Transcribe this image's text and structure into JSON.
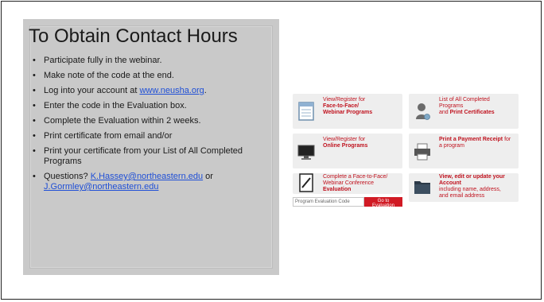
{
  "slide": {
    "title": "To Obtain Contact Hours",
    "bullets": [
      {
        "text": "Participate fully in the webinar."
      },
      {
        "text": "Make note of the code at the end."
      },
      {
        "text_before": "Log into your account at ",
        "link": "www.neusha.org",
        "text_after": "."
      },
      {
        "text": "Enter the code in the Evaluation box."
      },
      {
        "text": "Complete the Evaluation within 2 weeks."
      },
      {
        "text": "Print certificate from email and/or"
      },
      {
        "text": "Print your certificate from your List of All Completed Programs"
      },
      {
        "text_before": "Questions? ",
        "link1": "K.Hassey@northeastern.edu",
        "text_mid": " or ",
        "link2": "J.Gormley@northeastern.edu"
      }
    ]
  },
  "cards": [
    {
      "line1": "View/Register for",
      "line2_bold": "Face-to-Face/",
      "line3_bold": "Webinar Programs",
      "icon": "calendar-icon"
    },
    {
      "line1": "List of All Completed",
      "line2": "Programs",
      "line3_prefix": "and ",
      "line3_bold": "Print Certificates",
      "icon": "user-certificate-icon"
    },
    {
      "line1": "View/Register for",
      "line2_bold": "Online Programs",
      "icon": "monitor-icon"
    },
    {
      "line1_bold": "Print a Payment Receipt",
      "line1_suffix": " for",
      "line2": "a program",
      "icon": "printer-icon"
    },
    {
      "line1": "Complete a Face-to-Face/",
      "line2": "Webinar Conference",
      "line3_bold": "Evaluation",
      "icon": "edit-document-icon"
    },
    {
      "line1_bold": "View, edit or update your",
      "line2_bold": "Account",
      "line3": "including name, address,",
      "line4": "and email address",
      "icon": "folder-icon"
    }
  ],
  "evaluation": {
    "placeholder": "Program Evaluation Code",
    "button_label": "Go to Evaluation"
  }
}
